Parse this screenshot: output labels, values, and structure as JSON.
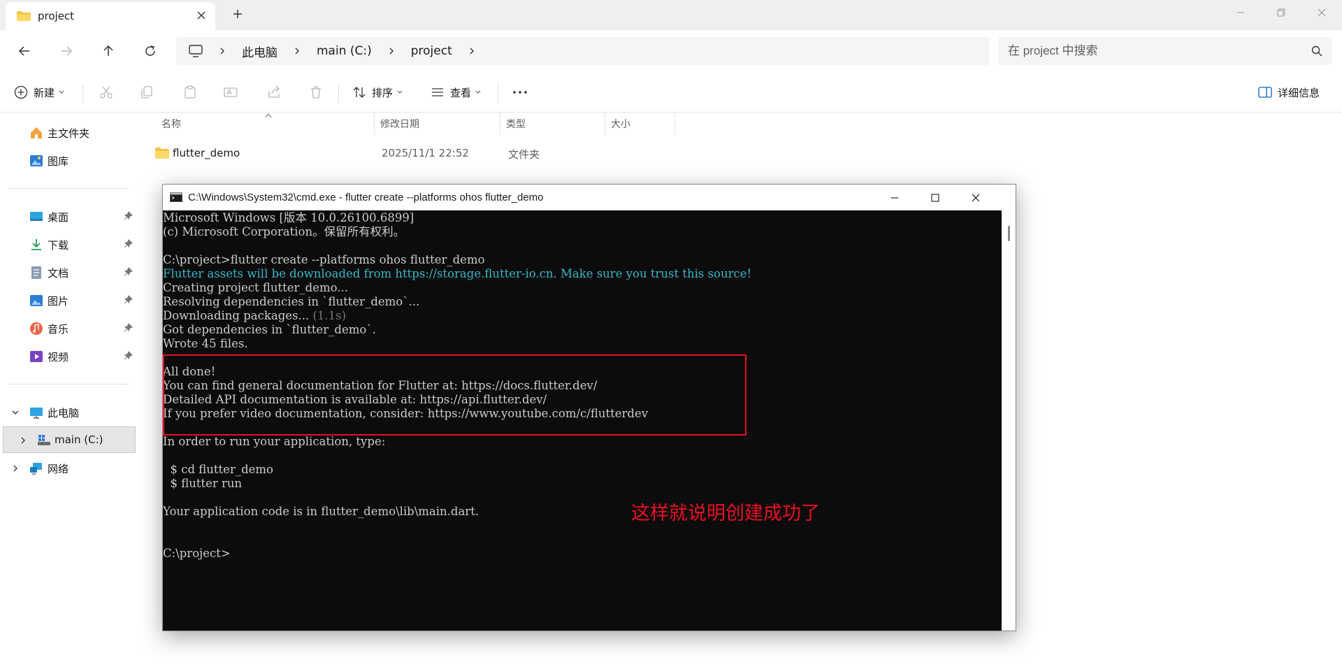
{
  "tab": {
    "title": "project"
  },
  "address": {
    "crumbs": [
      "此电脑",
      "main (C:)",
      "project"
    ]
  },
  "search": {
    "placeholder": "在 project 中搜索"
  },
  "toolbar": {
    "new_label": "新建",
    "sort_label": "排序",
    "view_label": "查看",
    "details_label": "详细信息"
  },
  "nav": {
    "home": "主文件夹",
    "gallery": "图库",
    "desktop": "桌面",
    "downloads": "下载",
    "documents": "文档",
    "pictures": "图片",
    "music": "音乐",
    "videos": "视频",
    "this_pc": "此电脑",
    "drive_c": "main (C:)",
    "network": "网络"
  },
  "columns": {
    "name": "名称",
    "date": "修改日期",
    "type": "类型",
    "size": "大小"
  },
  "files": [
    {
      "name": "flutter_demo",
      "date": "2025/11/1 22:52",
      "type": "文件夹"
    }
  ],
  "cmd": {
    "title": "C:\\Windows\\System32\\cmd.exe - flutter  create --platforms ohos flutter_demo",
    "lines": [
      {
        "text": "Microsoft Windows [版本 10.0.26100.6899]",
        "style": ""
      },
      {
        "text": "(c) Microsoft Corporation。保留所有权利。",
        "style": ""
      },
      {
        "text": "",
        "style": ""
      },
      {
        "text": "C:\\project>flutter create --platforms ohos flutter_demo",
        "style": ""
      },
      {
        "text": "Flutter assets will be downloaded from https://storage.flutter-io.cn. Make sure you trust this source!",
        "style": "cyan"
      },
      {
        "text": "Creating project flutter_demo...",
        "style": ""
      },
      {
        "text": "Resolving dependencies in `flutter_demo`...",
        "style": ""
      },
      {
        "text": "Downloading packages...",
        "style": "",
        "suffix": " (1.1s)"
      },
      {
        "text": "Got dependencies in `flutter_demo`.",
        "style": ""
      },
      {
        "text": "Wrote 45 files.",
        "style": ""
      },
      {
        "text": "",
        "style": ""
      },
      {
        "text": "All done!",
        "style": ""
      },
      {
        "text": "You can find general documentation for Flutter at: https://docs.flutter.dev/",
        "style": ""
      },
      {
        "text": "Detailed API documentation is available at: https://api.flutter.dev/",
        "style": ""
      },
      {
        "text": "If you prefer video documentation, consider: https://www.youtube.com/c/flutterdev",
        "style": ""
      },
      {
        "text": "",
        "style": ""
      },
      {
        "text": "In order to run your application, type:",
        "style": ""
      },
      {
        "text": "",
        "style": ""
      },
      {
        "text": "  $ cd flutter_demo",
        "style": ""
      },
      {
        "text": "  $ flutter run",
        "style": ""
      },
      {
        "text": "",
        "style": ""
      },
      {
        "text": "Your application code is in flutter_demo\\lib\\main.dart.",
        "style": ""
      },
      {
        "text": "",
        "style": ""
      },
      {
        "text": "",
        "style": ""
      },
      {
        "text": "C:\\project>",
        "style": ""
      }
    ]
  },
  "annotation": "这样就说明创建成功了",
  "colors": {
    "accent": "#0067c0",
    "highlight_box": "#e81123",
    "cmd_bg": "#0c0c0c",
    "cmd_text": "#cccccc",
    "cmd_cyan": "#3ab7c9"
  }
}
